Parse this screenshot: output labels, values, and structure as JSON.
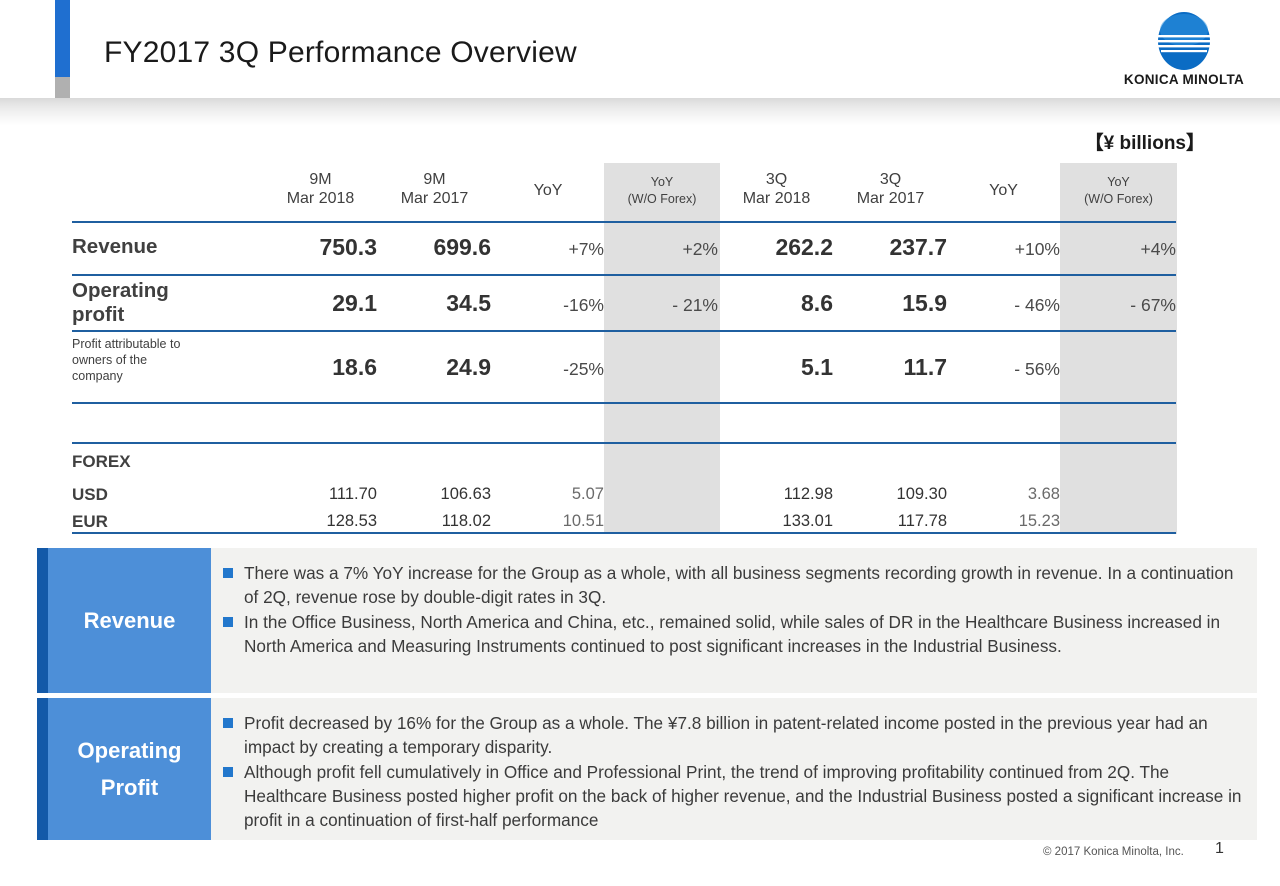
{
  "header": {
    "title": "FY2017 3Q Performance Overview",
    "logo_text": "KONICA MINOLTA",
    "logo_icon": "konica-minolta-globe-icon"
  },
  "units_label": "【¥ billions】",
  "table": {
    "columns": [
      {
        "line1": "",
        "line2": "",
        "key": "label"
      },
      {
        "line1": "9M",
        "line2": "Mar 2018",
        "key": "9m_2018"
      },
      {
        "line1": "9M",
        "line2": "Mar 2017",
        "key": "9m_2017"
      },
      {
        "line1": "YoY",
        "line2": "",
        "key": "9m_yoy"
      },
      {
        "line1": "YoY",
        "line2": "(W/O Forex)",
        "key": "9m_yoy_wo"
      },
      {
        "line1": "3Q",
        "line2": "Mar 2018",
        "key": "3q_2018"
      },
      {
        "line1": "3Q",
        "line2": "Mar 2017",
        "key": "3q_2017"
      },
      {
        "line1": "YoY",
        "line2": "",
        "key": "3q_yoy"
      },
      {
        "line1": "YoY",
        "line2": "(W/O Forex)",
        "key": "3q_yoy_wo"
      }
    ],
    "rows": [
      {
        "label": "Revenue",
        "label2": "",
        "label3": "",
        "v1": "750.3",
        "v2": "699.6",
        "v3": "+7%",
        "v4": "+2%",
        "v5": "262.2",
        "v6": "237.7",
        "v7": "+10%",
        "v8": "+4%"
      },
      {
        "label": "Operating",
        "label2": "profit",
        "label3": "",
        "v1": "29.1",
        "v2": "34.5",
        "v3": "-16%",
        "v4": "- 21%",
        "v5": "8.6",
        "v6": "15.9",
        "v7": "- 46%",
        "v8": "- 67%"
      },
      {
        "label": "Profit attributable to",
        "label2": "owners of the",
        "label3": "company",
        "v1": "18.6",
        "v2": "24.9",
        "v3": "-25%",
        "v4": "",
        "v5": "5.1",
        "v6": "11.7",
        "v7": "- 56%",
        "v8": ""
      }
    ],
    "forex": {
      "title": "FOREX",
      "rows": [
        {
          "label": "USD",
          "v1": "111.70",
          "v2": "106.63",
          "v3": "5.07",
          "v4": "",
          "v5": "112.98",
          "v6": "109.30",
          "v7": "3.68",
          "v8": ""
        },
        {
          "label": "EUR",
          "v1": "128.53",
          "v2": "118.02",
          "v3": "10.51",
          "v4": "",
          "v5": "133.01",
          "v6": "117.78",
          "v7": "15.23",
          "v8": ""
        }
      ]
    }
  },
  "comments": [
    {
      "tag_line1": "Revenue",
      "tag_line2": "",
      "bullets": [
        "There was a 7% YoY increase for the Group as a whole, with all business segments recording growth in revenue. In a continuation of 2Q, revenue rose by double-digit rates in 3Q.",
        "In the Office Business, North America and China, etc., remained solid, while sales of DR in the Healthcare Business increased in North America and Measuring Instruments continued to post significant increases in the Industrial Business."
      ]
    },
    {
      "tag_line1": "Operating",
      "tag_line2": "Profit",
      "bullets": [
        "Profit decreased by 16% for the Group as a whole. The ¥7.8 billion in patent-related income posted in the previous year had an impact by creating a temporary disparity.",
        "Although profit fell cumulatively in Office and Professional Print, the trend of improving profitability continued from 2Q. The Healthcare Business posted higher profit on the back of higher revenue, and the Industrial Business posted a significant increase in profit in a continuation of first-half performance"
      ]
    }
  ],
  "footer": {
    "copyright": "© 2017 Konica Minolta, Inc.",
    "page_number": "1"
  },
  "colors": {
    "accent_blue": "#1f6fd0",
    "rule_blue": "#1f5fa0",
    "tag_blue": "#4d8fd8",
    "tag_dark_blue": "#1359a8",
    "shade_gray": "#e0e0e0",
    "panel_gray": "#f2f2f0"
  }
}
